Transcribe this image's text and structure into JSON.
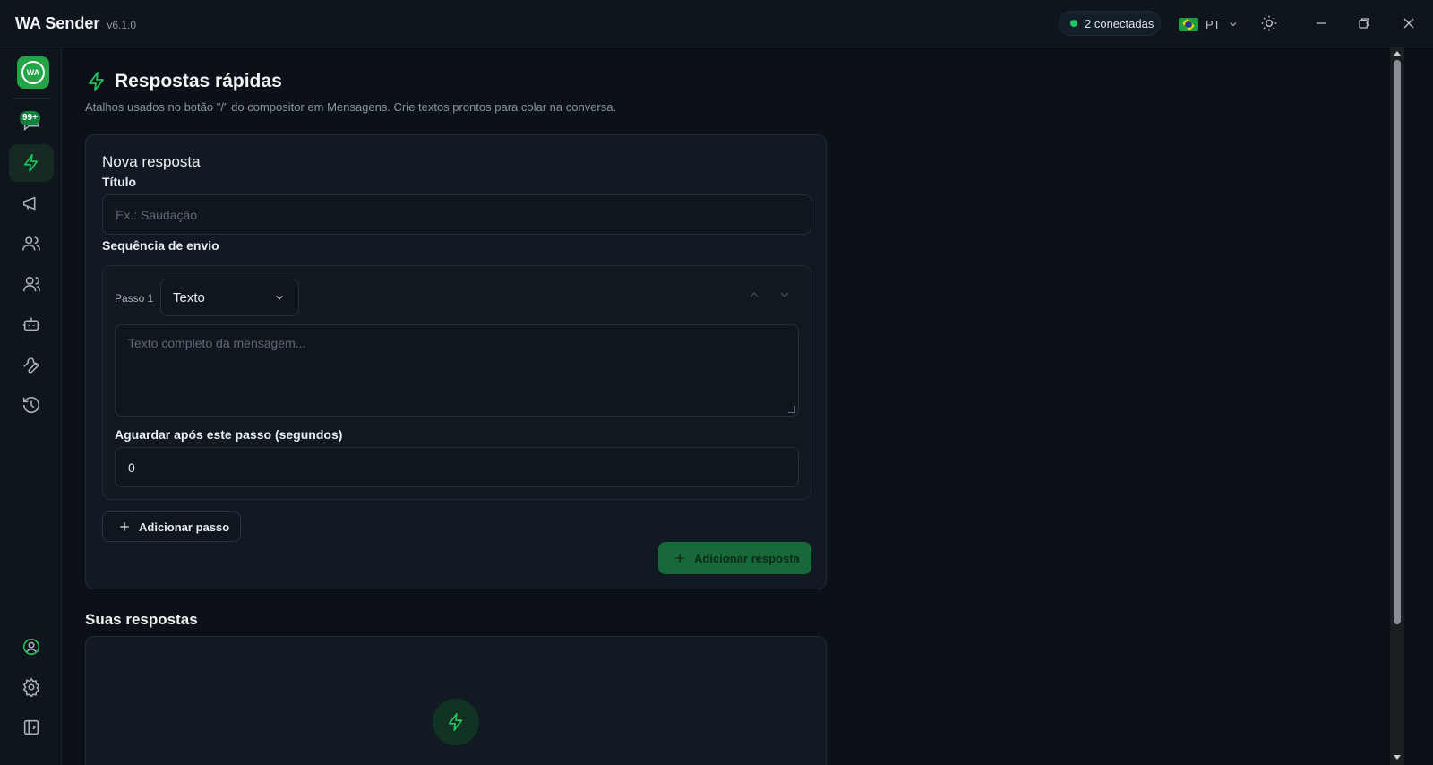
{
  "app": {
    "name": "WA Sender",
    "version": "v6.1.0"
  },
  "titlebar": {
    "connections": "2 conectadas",
    "language": "PT",
    "icons": [
      "sun-icon",
      "minimize-icon",
      "restore-icon",
      "close-icon"
    ]
  },
  "sidebar": {
    "logo_text": "WA",
    "messages_badge": "99+",
    "items": [
      {
        "name": "messages",
        "icon": "message-icon"
      },
      {
        "name": "quick-replies",
        "icon": "bolt-icon",
        "active": true
      },
      {
        "name": "campaigns",
        "icon": "megaphone-icon"
      },
      {
        "name": "contacts",
        "icon": "users-icon"
      },
      {
        "name": "groups",
        "icon": "group-icon"
      },
      {
        "name": "bot",
        "icon": "bot-icon"
      },
      {
        "name": "tools",
        "icon": "wrench-icon"
      },
      {
        "name": "history",
        "icon": "history-icon"
      },
      {
        "name": "account",
        "icon": "user-circle-icon"
      },
      {
        "name": "settings",
        "icon": "gear-icon"
      },
      {
        "name": "collapse",
        "icon": "sidebar-toggle-icon"
      }
    ]
  },
  "page": {
    "title": "Respostas rápidas",
    "subtitle": "Atalhos usados no botão \"/\" do compositor em Mensagens. Crie textos prontos para colar na conversa."
  },
  "form": {
    "card_title": "Nova resposta",
    "title_label": "Título",
    "title_placeholder": "Ex.: Saudação",
    "sequence_label": "Sequência de envio",
    "step": {
      "label": "Passo 1",
      "type_selected": "Texto",
      "message_placeholder": "Texto completo da mensagem...",
      "wait_label": "Aguardar após este passo (segundos)",
      "wait_value": "0"
    },
    "add_step_label": "Adicionar passo",
    "submit_label": "Adicionar resposta"
  },
  "list": {
    "title": "Suas respostas"
  },
  "colors": {
    "accent": "#22c55e",
    "primary_button": "#17693a",
    "background": "#0b1117",
    "card": "#111a22"
  }
}
